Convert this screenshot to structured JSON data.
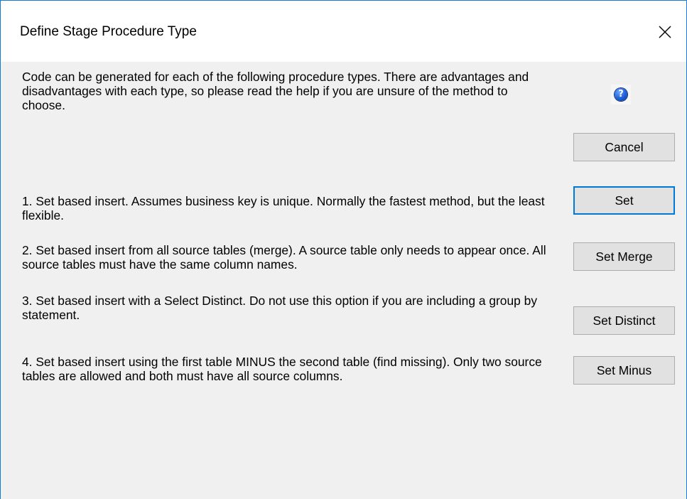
{
  "window": {
    "title": "Define Stage Procedure Type"
  },
  "intro": {
    "text": "Code can be generated for each of the following procedure types. There are advantages and disadvantages with each type, so please read the help if you are unsure of the method to choose."
  },
  "buttons": {
    "cancel": "Cancel"
  },
  "options": [
    {
      "text": "1. Set based insert. Assumes business key is unique. Normally the fastest method, but the least flexible.",
      "button": "Set"
    },
    {
      "text": "2. Set based insert from all source tables (merge). A source table only needs to appear once. All source tables must have the same column names.",
      "button": "Set Merge"
    },
    {
      "text": "3. Set based insert with a Select Distinct.   Do not use this option if you are including a group by statement.",
      "button": "Set Distinct"
    },
    {
      "text": "4. Set based insert using the first table MINUS the second table (find missing). Only two source tables are allowed and both must have all source columns.",
      "button": "Set Minus"
    }
  ],
  "icons": {
    "help": "question-icon",
    "close": "close-icon"
  },
  "colors": {
    "accent": "#0078d7",
    "window_border": "#1a79d6",
    "background": "#f0f0f0"
  }
}
